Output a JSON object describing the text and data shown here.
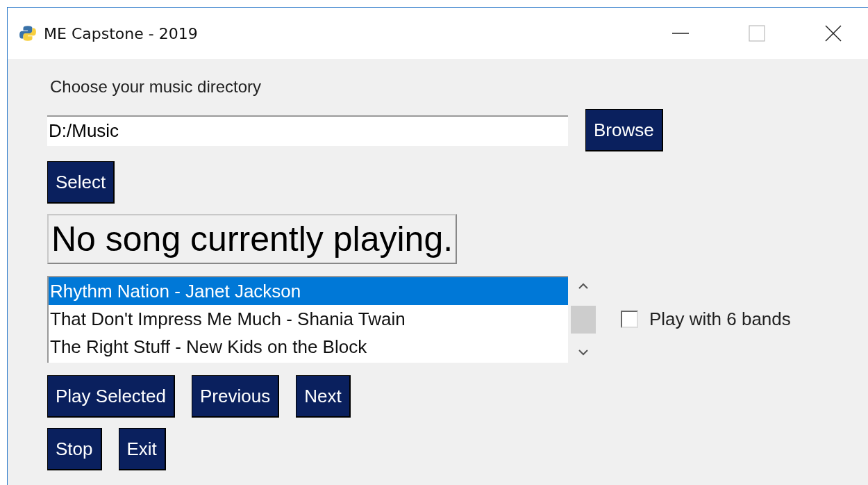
{
  "window": {
    "title": "ME Capstone - 2019"
  },
  "directory_label": "Choose your music directory",
  "directory_field": {
    "value": "D:/Music"
  },
  "browse_button": "Browse",
  "select_button": "Select",
  "now_playing": "No song currently playing.",
  "songs": [
    {
      "title": "Rhythm Nation - Janet Jackson",
      "selected": true
    },
    {
      "title": "That Don't Impress Me Much - Shania Twain",
      "selected": false
    },
    {
      "title": "The Right Stuff - New Kids on the Block",
      "selected": false
    }
  ],
  "bands_checkbox": {
    "label": "Play with 6 bands",
    "checked": false
  },
  "control_rows": [
    [
      "Play Selected",
      "Previous",
      "Next"
    ],
    [
      "Stop",
      "Exit"
    ]
  ]
}
